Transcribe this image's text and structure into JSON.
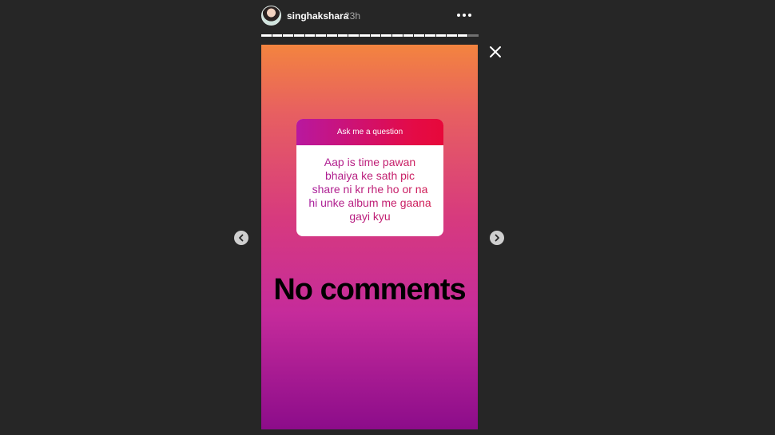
{
  "header": {
    "username": "singhakshara",
    "timestamp": "23h"
  },
  "progress": {
    "segments_total": 20,
    "segments_viewed": 19
  },
  "story": {
    "question_sticker": {
      "title": "Ask me a question",
      "answer": "Aap is time pawan\nbhaiya ke sath  pic\nshare ni kr rhe ho or na\nhi unke album me gaana\ngayi kyu"
    },
    "caption": "No comments"
  },
  "icons": {
    "more": "more-dots-icon",
    "close": "close-icon",
    "prev": "chevron-left-icon",
    "next": "chevron-right-icon"
  },
  "colors": {
    "background": "#262626",
    "gradient_top": "#f3843f",
    "gradient_bottom": "#8c0c8a"
  }
}
